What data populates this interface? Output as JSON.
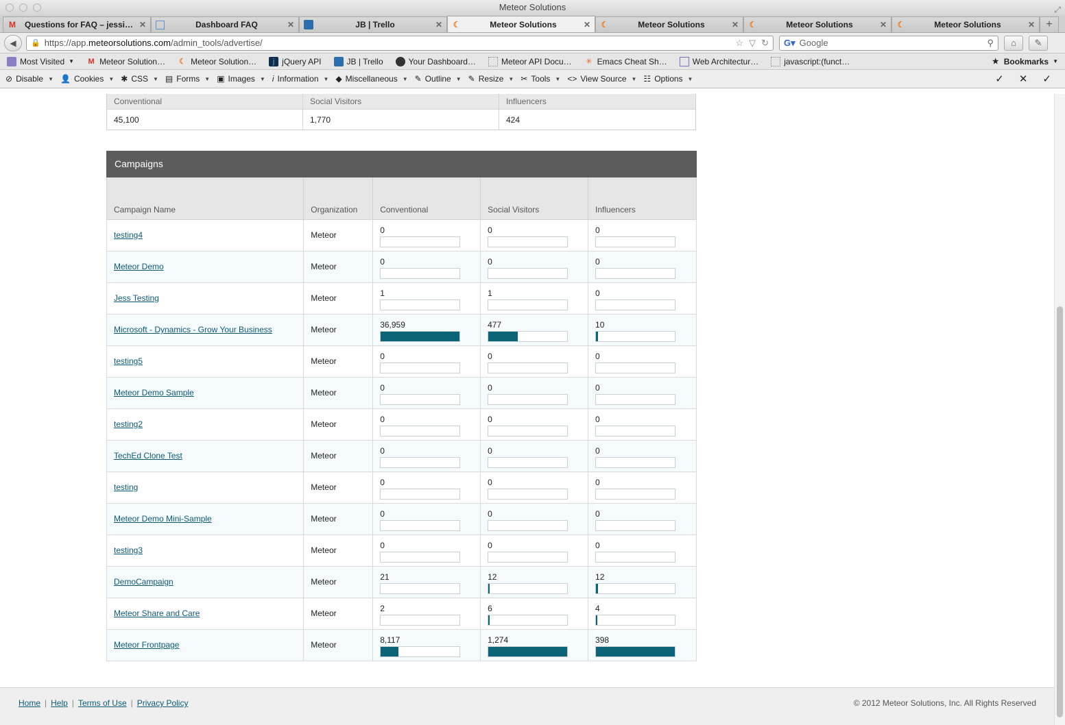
{
  "window": {
    "title": "Meteor Solutions"
  },
  "tabs": [
    {
      "label": "Questions for FAQ – jessi…",
      "icon": "gmail-icon"
    },
    {
      "label": "Dashboard FAQ",
      "icon": "page-icon"
    },
    {
      "label": "JB | Trello",
      "icon": "trello-icon"
    },
    {
      "label": "Meteor Solutions",
      "icon": "meteor-icon",
      "active": true
    },
    {
      "label": "Meteor Solutions",
      "icon": "meteor-icon"
    },
    {
      "label": "Meteor Solutions",
      "icon": "meteor-icon"
    },
    {
      "label": "Meteor Solutions",
      "icon": "meteor-icon"
    }
  ],
  "nav": {
    "url_prefix": "https://app.",
    "url_domain": "meteorsolutions.com",
    "url_path": "/admin_tools/advertise/",
    "search_placeholder": "Google"
  },
  "bookmarks": [
    {
      "label": "Most Visited",
      "icon": "most-visited-icon",
      "dropdown": true
    },
    {
      "label": "Meteor Solution…",
      "icon": "gmail-icon"
    },
    {
      "label": "Meteor Solution…",
      "icon": "meteor-icon"
    },
    {
      "label": "jQuery API",
      "icon": "jquery-icon"
    },
    {
      "label": "JB | Trello",
      "icon": "trello-icon"
    },
    {
      "label": "Your Dashboard…",
      "icon": "github-icon"
    },
    {
      "label": "Meteor API Docu…",
      "icon": "page-icon"
    },
    {
      "label": "Emacs Cheat Sh…",
      "icon": "emacs-icon"
    },
    {
      "label": "Web Architectur…",
      "icon": "page-icon"
    },
    {
      "label": "javascript:(funct…",
      "icon": "page-icon"
    }
  ],
  "bookmarks_menu": "Bookmarks",
  "devtools": [
    {
      "label": "Disable",
      "icon": "disable-icon"
    },
    {
      "label": "Cookies",
      "icon": "cookies-icon"
    },
    {
      "label": "CSS",
      "icon": "css-icon"
    },
    {
      "label": "Forms",
      "icon": "forms-icon"
    },
    {
      "label": "Images",
      "icon": "images-icon"
    },
    {
      "label": "Information",
      "icon": "information-icon"
    },
    {
      "label": "Miscellaneous",
      "icon": "miscellaneous-icon"
    },
    {
      "label": "Outline",
      "icon": "outline-icon"
    },
    {
      "label": "Resize",
      "icon": "resize-icon"
    },
    {
      "label": "Tools",
      "icon": "tools-icon"
    },
    {
      "label": "View Source",
      "icon": "view-source-icon"
    },
    {
      "label": "Options",
      "icon": "options-icon"
    }
  ],
  "summary": {
    "headers": [
      "Conventional",
      "Social Visitors",
      "Influencers"
    ],
    "values": [
      "45,100",
      "1,770",
      "424"
    ]
  },
  "campaigns": {
    "title": "Campaigns",
    "headers": [
      "Campaign Name",
      "Organization",
      "Conventional",
      "Social Visitors",
      "Influencers"
    ],
    "bar_color": "#0b6377",
    "rows": [
      {
        "name": "testing4",
        "org": "Meteor",
        "conventional": "0",
        "social": "0",
        "influencers": "0",
        "conv_pct": 0,
        "soc_pct": 0,
        "inf_pct": 0
      },
      {
        "name": "Meteor Demo",
        "org": "Meteor",
        "conventional": "0",
        "social": "0",
        "influencers": "0",
        "conv_pct": 0,
        "soc_pct": 0,
        "inf_pct": 0
      },
      {
        "name": "Jess Testing",
        "org": "Meteor",
        "conventional": "1",
        "social": "1",
        "influencers": "0",
        "conv_pct": 0,
        "soc_pct": 0,
        "inf_pct": 0
      },
      {
        "name": "Microsoft - Dynamics - Grow Your Business",
        "org": "Meteor",
        "conventional": "36,959",
        "social": "477",
        "influencers": "10",
        "conv_pct": 100,
        "soc_pct": 37,
        "inf_pct": 3
      },
      {
        "name": "testing5",
        "org": "Meteor",
        "conventional": "0",
        "social": "0",
        "influencers": "0",
        "conv_pct": 0,
        "soc_pct": 0,
        "inf_pct": 0
      },
      {
        "name": "Meteor Demo Sample",
        "org": "Meteor",
        "conventional": "0",
        "social": "0",
        "influencers": "0",
        "conv_pct": 0,
        "soc_pct": 0,
        "inf_pct": 0
      },
      {
        "name": "testing2",
        "org": "Meteor",
        "conventional": "0",
        "social": "0",
        "influencers": "0",
        "conv_pct": 0,
        "soc_pct": 0,
        "inf_pct": 0
      },
      {
        "name": "TechEd Clone Test",
        "org": "Meteor",
        "conventional": "0",
        "social": "0",
        "influencers": "0",
        "conv_pct": 0,
        "soc_pct": 0,
        "inf_pct": 0
      },
      {
        "name": "testing",
        "org": "Meteor",
        "conventional": "0",
        "social": "0",
        "influencers": "0",
        "conv_pct": 0,
        "soc_pct": 0,
        "inf_pct": 0
      },
      {
        "name": "Meteor Demo Mini-Sample",
        "org": "Meteor",
        "conventional": "0",
        "social": "0",
        "influencers": "0",
        "conv_pct": 0,
        "soc_pct": 0,
        "inf_pct": 0
      },
      {
        "name": "testing3",
        "org": "Meteor",
        "conventional": "0",
        "social": "0",
        "influencers": "0",
        "conv_pct": 0,
        "soc_pct": 0,
        "inf_pct": 0
      },
      {
        "name": "DemoCampaign",
        "org": "Meteor",
        "conventional": "21",
        "social": "12",
        "influencers": "12",
        "conv_pct": 0,
        "soc_pct": 1,
        "inf_pct": 3
      },
      {
        "name": "Meteor Share and Care",
        "org": "Meteor",
        "conventional": "2",
        "social": "6",
        "influencers": "4",
        "conv_pct": 0,
        "soc_pct": 1,
        "inf_pct": 1
      },
      {
        "name": "Meteor Frontpage",
        "org": "Meteor",
        "conventional": "8,117",
        "social": "1,274",
        "influencers": "398",
        "conv_pct": 22,
        "soc_pct": 100,
        "inf_pct": 100
      }
    ]
  },
  "footer": {
    "links": [
      "Home",
      "Help",
      "Terms of Use",
      "Privacy Policy"
    ],
    "copyright": "© 2012 Meteor Solutions, Inc. All Rights Reserved"
  }
}
